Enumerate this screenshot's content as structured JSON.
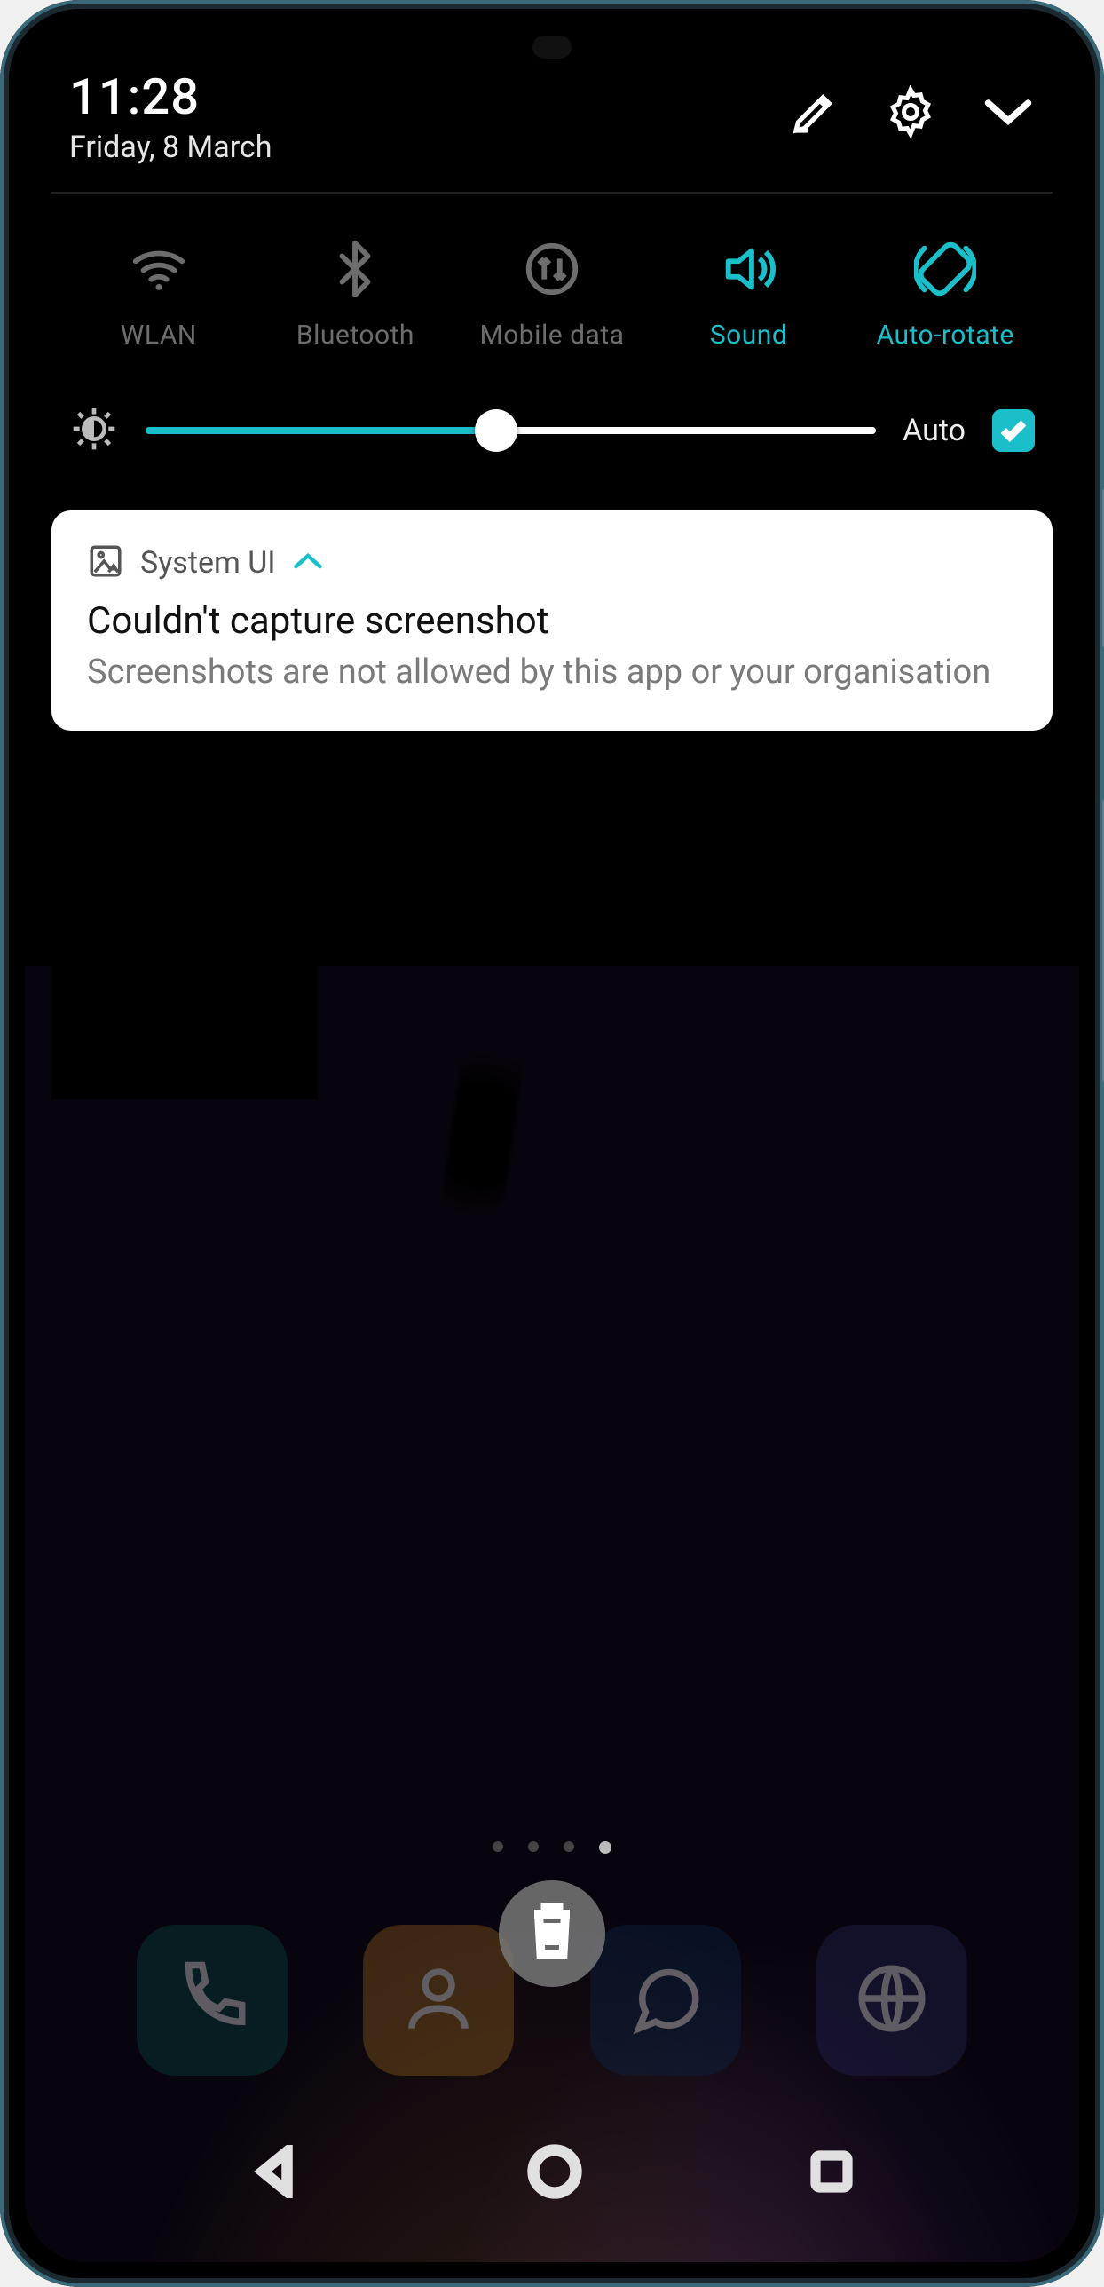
{
  "status": {
    "time": "11:28",
    "date": "Friday, 8 March"
  },
  "quick_toggles": [
    {
      "id": "wlan",
      "label": "WLAN",
      "active": false,
      "icon": "wifi-icon"
    },
    {
      "id": "bluetooth",
      "label": "Bluetooth",
      "active": false,
      "icon": "bluetooth-icon"
    },
    {
      "id": "mobiledata",
      "label": "Mobile data",
      "active": false,
      "icon": "mobiledata-icon"
    },
    {
      "id": "sound",
      "label": "Sound",
      "active": true,
      "icon": "sound-icon"
    },
    {
      "id": "autorotate",
      "label": "Auto-rotate",
      "active": true,
      "icon": "autorotate-icon"
    }
  ],
  "brightness": {
    "value_percent": 48,
    "auto_label": "Auto",
    "auto_checked": true
  },
  "notification": {
    "app": "System UI",
    "title": "Couldn't capture screenshot",
    "body": "Screenshots are not allowed by this app or your organisation"
  },
  "pager": {
    "count": 4,
    "active_index": 3
  },
  "dock_apps": [
    {
      "id": "phone",
      "name": "phone-app"
    },
    {
      "id": "contacts",
      "name": "contacts-app"
    },
    {
      "id": "messages",
      "name": "messages-app"
    },
    {
      "id": "browser",
      "name": "browser-app"
    }
  ],
  "colors": {
    "accent": "#1bbfc9"
  }
}
